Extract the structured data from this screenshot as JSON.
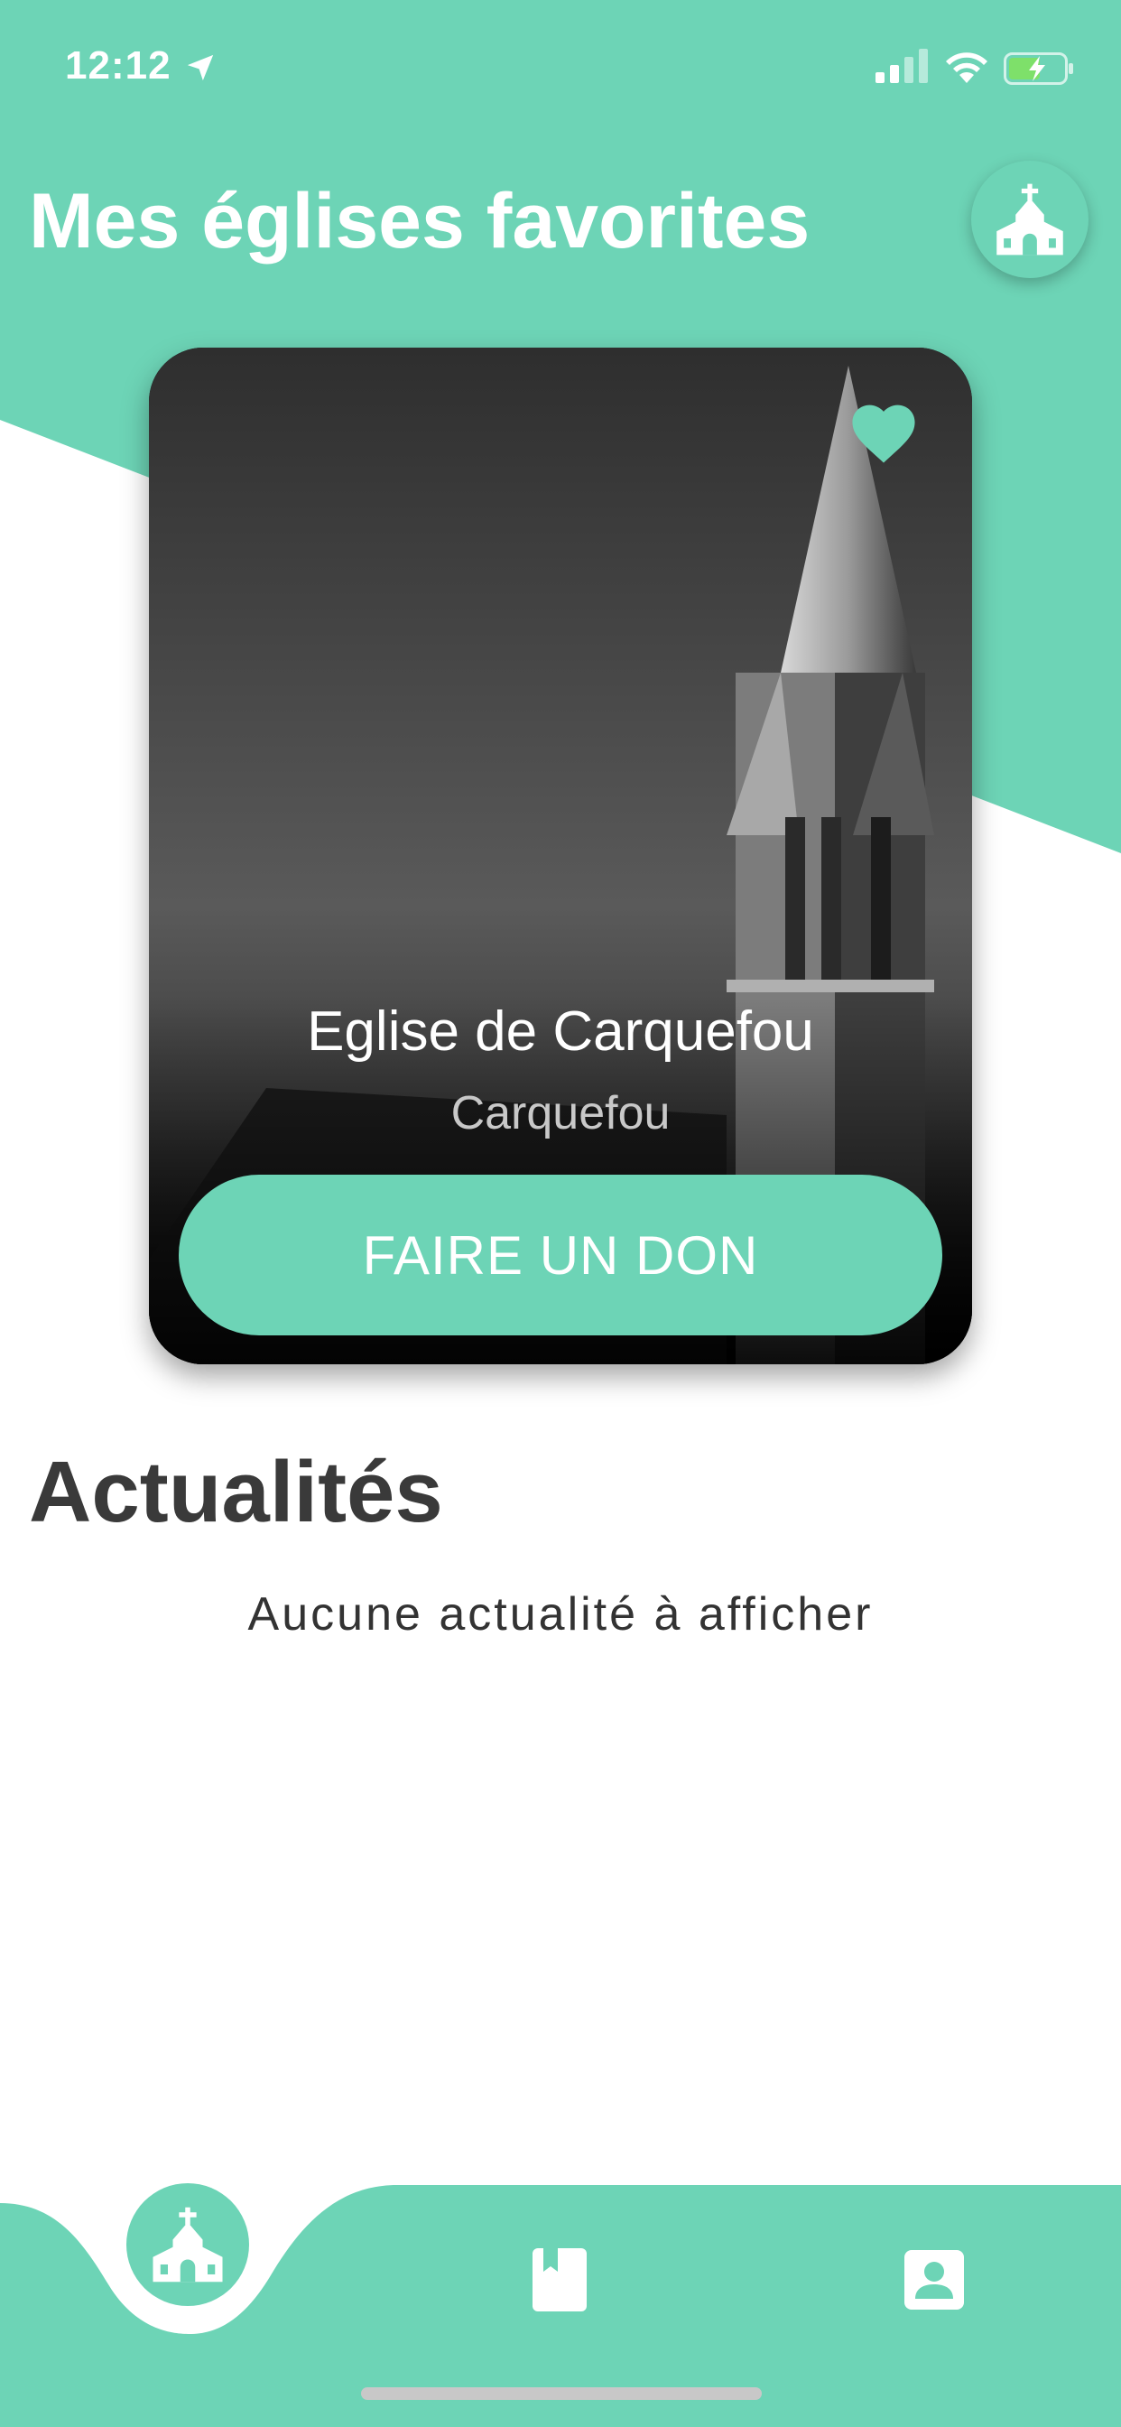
{
  "status_bar": {
    "time": "12:12"
  },
  "header": {
    "title": "Mes églises favorites"
  },
  "icons": {
    "church": "church-icon",
    "heart": "heart-icon",
    "book": "book-icon",
    "profile": "profile-icon",
    "location_arrow": "location-arrow-icon",
    "signal": "signal-icon",
    "wifi": "wifi-icon",
    "battery": "battery-charging-icon"
  },
  "card": {
    "name": "Eglise de Carquefou",
    "city": "Carquefou",
    "donate_label": "FAIRE UN DON",
    "favorited": true
  },
  "news": {
    "title": "Actualités",
    "empty_message": "Aucune actualité à afficher"
  },
  "colors": {
    "accent": "#6dd4b6",
    "title_dark": "#3a3a3a",
    "background": "#ffffff"
  }
}
